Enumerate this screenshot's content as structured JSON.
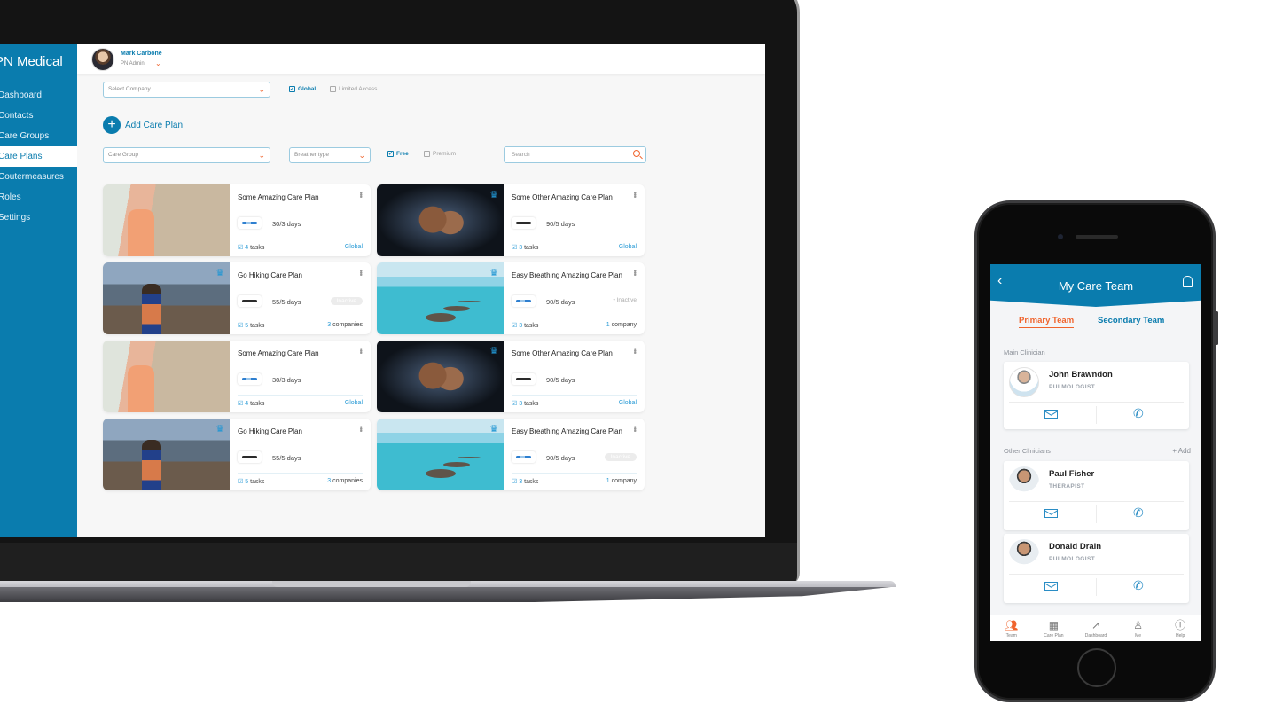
{
  "laptop": {
    "brand": "PN Medical",
    "sidebar": {
      "items": [
        {
          "label": "Dashboard",
          "active": false
        },
        {
          "label": "Contacts",
          "active": false
        },
        {
          "label": "Care Groups",
          "active": false
        },
        {
          "label": "Care Plans",
          "active": true
        },
        {
          "label": "Coutermeasures",
          "active": false
        },
        {
          "label": "Roles",
          "active": false
        },
        {
          "label": "Settings",
          "active": false
        }
      ]
    },
    "user": {
      "name": "Mark Carbone",
      "role": "PN Admin"
    },
    "filters": {
      "company_select": {
        "placeholder": "Select Company"
      },
      "global_checkbox": {
        "label": "Global",
        "checked": true
      },
      "limited_checkbox": {
        "label": "Limited Access",
        "checked": false
      },
      "care_group_select": {
        "placeholder": "Care Group"
      },
      "breather_select": {
        "placeholder": "Breather type"
      },
      "free_checkbox": {
        "label": "Free",
        "checked": true
      },
      "premium_checkbox": {
        "label": "Premium",
        "checked": false
      },
      "search": {
        "placeholder": "Search"
      }
    },
    "add_button": {
      "label": "Add Care Plan",
      "icon": "plus-icon"
    },
    "cards": [
      {
        "title": "Some Amazing Care Plan",
        "image": "inhaler",
        "premium": false,
        "device": "blue",
        "days": "30/3 days",
        "status": "",
        "tasks_count": "4",
        "tasks_label": "tasks",
        "scope": "Global",
        "scope_count": ""
      },
      {
        "title": "Some Other Amazing Care Plan",
        "image": "fitness",
        "premium": true,
        "device": "black",
        "days": "90/5 days",
        "status": "",
        "tasks_count": "3",
        "tasks_label": "tasks",
        "scope": "Global",
        "scope_count": ""
      },
      {
        "title": "Go Hiking Care Plan",
        "image": "hiking",
        "premium": true,
        "device": "black",
        "days": "55/5 days",
        "status": "Inactive",
        "status_style": "pill",
        "tasks_count": "5",
        "tasks_label": "tasks",
        "scope": "companies",
        "scope_count": "3"
      },
      {
        "title": "Easy Breathing Amazing Care Plan",
        "image": "sea",
        "premium": true,
        "device": "blue",
        "days": "90/5 days",
        "status": "• Inactive",
        "status_style": "text",
        "tasks_count": "3",
        "tasks_label": "tasks",
        "scope": "company",
        "scope_count": "1"
      },
      {
        "title": "Some Amazing Care Plan",
        "image": "inhaler",
        "premium": false,
        "device": "blue",
        "days": "30/3 days",
        "status": "",
        "tasks_count": "4",
        "tasks_label": "tasks",
        "scope": "Global",
        "scope_count": ""
      },
      {
        "title": "Some Other Amazing Care Plan",
        "image": "fitness",
        "premium": true,
        "device": "black",
        "days": "90/5 days",
        "status": "",
        "tasks_count": "3",
        "tasks_label": "tasks",
        "scope": "Global",
        "scope_count": ""
      },
      {
        "title": "Go Hiking Care Plan",
        "image": "hiking",
        "premium": true,
        "device": "black",
        "days": "55/5 days",
        "status": "",
        "tasks_count": "5",
        "tasks_label": "tasks",
        "scope": "companies",
        "scope_count": "3"
      },
      {
        "title": "Easy Breathing Amazing Care Plan",
        "image": "sea",
        "premium": true,
        "device": "blue",
        "days": "90/5 days",
        "status": "Inactive",
        "status_style": "pill",
        "tasks_count": "3",
        "tasks_label": "tasks",
        "scope": "company",
        "scope_count": "1"
      }
    ],
    "colors": {
      "brand": "#0a7cae",
      "accent": "#f0642d",
      "link": "#2a9bd6"
    }
  },
  "phone": {
    "title": "My Care Team",
    "tabs": [
      {
        "label": "Primary Team",
        "active": true
      },
      {
        "label": "Secondary Team",
        "active": false
      }
    ],
    "main_label": "Main Clinician",
    "other_label": "Other Clinicians",
    "add_label": "+ Add",
    "clinicians": [
      {
        "name": "John Brawndon",
        "role": "PULMOLOGIST"
      },
      {
        "name": "Paul Fisher",
        "role": "THERAPIST"
      },
      {
        "name": "Donald Drain",
        "role": "PULMOLOGIST"
      }
    ],
    "tabbar": [
      {
        "label": "Team",
        "icon": "team-icon",
        "active": true
      },
      {
        "label": "Care Plan",
        "icon": "calendar-icon",
        "active": false
      },
      {
        "label": "Dashboard",
        "icon": "chart-icon",
        "active": false
      },
      {
        "label": "Me",
        "icon": "person-icon",
        "active": false
      },
      {
        "label": "Help",
        "icon": "info-icon",
        "active": false
      }
    ]
  }
}
